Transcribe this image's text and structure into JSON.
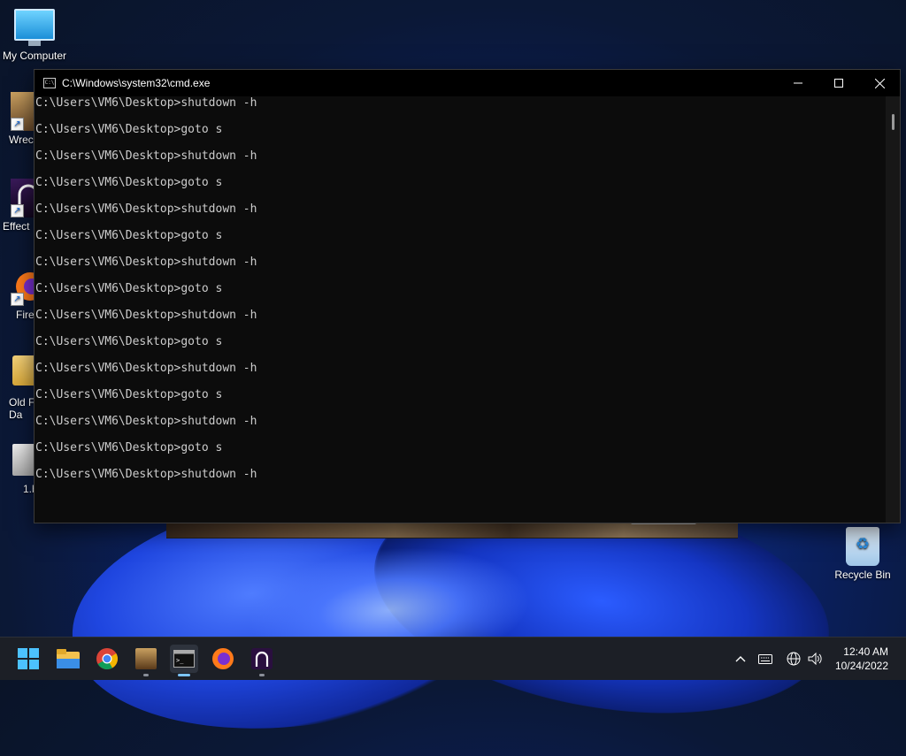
{
  "desktop": {
    "icons": [
      {
        "label": "My Computer"
      },
      {
        "label": "Wrec"
      },
      {
        "label": "Effect"
      },
      {
        "label": "Fire"
      },
      {
        "label": "Old F\nDa"
      },
      {
        "label": "1.b"
      },
      {
        "label": "Recycle Bin"
      }
    ]
  },
  "cmd_window": {
    "title": "C:\\Windows\\system32\\cmd.exe",
    "icon_text": "C:\\",
    "lines": [
      "C:\\Users\\VM6\\Desktop>shutdown -h",
      "C:\\Users\\VM6\\Desktop>goto s",
      "C:\\Users\\VM6\\Desktop>shutdown -h",
      "C:\\Users\\VM6\\Desktop>goto s",
      "C:\\Users\\VM6\\Desktop>shutdown -h",
      "C:\\Users\\VM6\\Desktop>goto s",
      "C:\\Users\\VM6\\Desktop>shutdown -h",
      "C:\\Users\\VM6\\Desktop>goto s",
      "C:\\Users\\VM6\\Desktop>shutdown -h",
      "C:\\Users\\VM6\\Desktop>goto s",
      "C:\\Users\\VM6\\Desktop>shutdown -h",
      "C:\\Users\\VM6\\Desktop>goto s",
      "C:\\Users\\VM6\\Desktop>shutdown -h",
      "C:\\Users\\VM6\\Desktop>goto s",
      "C:\\Users\\VM6\\Desktop>shutdown -h"
    ]
  },
  "taskbar": {
    "apps": [
      "start-icon",
      "file-explorer-icon",
      "chrome-icon",
      "game-icon",
      "cmd-icon",
      "firefox-icon",
      "effect-icon"
    ],
    "active_app": "cmd-icon",
    "clock_time": "12:40 AM",
    "clock_date": "10/24/2022"
  },
  "colors": {
    "console_bg": "#0c0c0c",
    "console_text": "#cccccc",
    "taskbar_bg": "#1c1f26",
    "accent": "#7cc4ff"
  }
}
